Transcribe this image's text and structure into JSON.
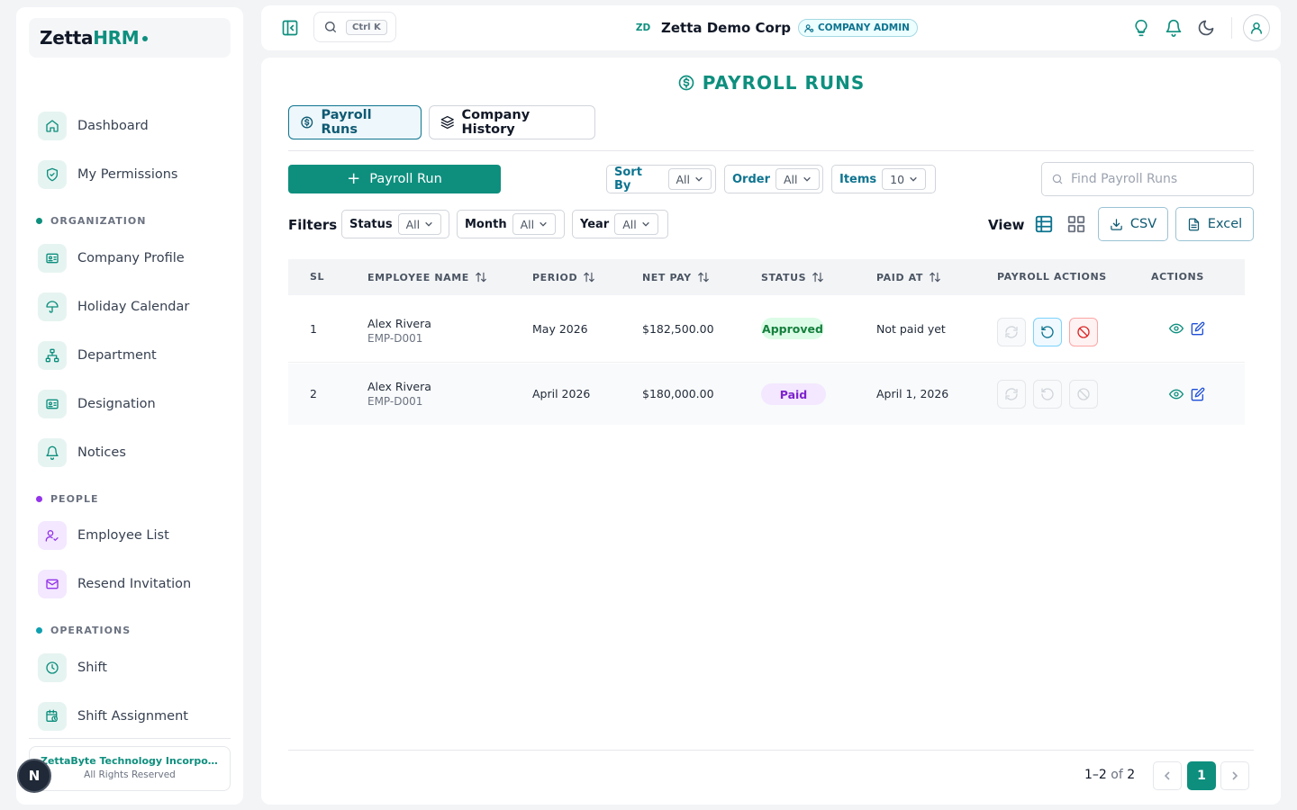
{
  "brand": {
    "name_main": "Zetta",
    "name_accent": "HRM"
  },
  "sidebar": {
    "items": [
      {
        "label": "Dashboard"
      },
      {
        "label": "My Permissions"
      }
    ],
    "sections": [
      {
        "title": "ORGANIZATION",
        "items": [
          {
            "label": "Company Profile"
          },
          {
            "label": "Holiday Calendar"
          },
          {
            "label": "Department"
          },
          {
            "label": "Designation"
          },
          {
            "label": "Notices"
          }
        ]
      },
      {
        "title": "PEOPLE",
        "items": [
          {
            "label": "Employee List"
          },
          {
            "label": "Resend Invitation"
          }
        ]
      },
      {
        "title": "OPERATIONS",
        "items": [
          {
            "label": "Shift"
          },
          {
            "label": "Shift Assignment"
          }
        ]
      }
    ],
    "footer": {
      "company": "ZettaByte Technology Incorporated",
      "rights": "All Rights Reserved"
    },
    "assistant_badge": "N"
  },
  "topbar": {
    "search_shortcut": "Ctrl K",
    "company_initials": "ZD",
    "company_name": "Zetta Demo Corp",
    "role_badge": "COMPANY ADMIN"
  },
  "page": {
    "title": "PAYROLL RUNS",
    "tabs": [
      {
        "label": "Payroll Runs",
        "active": true
      },
      {
        "label": "Company History",
        "active": false
      }
    ],
    "add_button": "Payroll Run",
    "sort": {
      "label": "Sort By",
      "value": "All"
    },
    "order": {
      "label": "Order",
      "value": "All"
    },
    "items": {
      "label": "Items",
      "value": "10"
    },
    "search_placeholder": "Find Payroll Runs",
    "filters_label": "Filters",
    "filters": [
      {
        "label": "Status",
        "value": "All"
      },
      {
        "label": "Month",
        "value": "All"
      },
      {
        "label": "Year",
        "value": "All"
      }
    ],
    "view_label": "View",
    "export_csv": "CSV",
    "export_excel": "Excel"
  },
  "table": {
    "columns": [
      "SL",
      "EMPLOYEE NAME",
      "PERIOD",
      "NET PAY",
      "STATUS",
      "PAID AT",
      "PAYROLL ACTIONS",
      "ACTIONS"
    ],
    "rows": [
      {
        "sl": "1",
        "name": "Alex Rivera",
        "emp_id": "EMP-D001",
        "period": "May 2026",
        "net_pay": "$182,500.00",
        "status": "Approved",
        "paid_at": "Not paid yet"
      },
      {
        "sl": "2",
        "name": "Alex Rivera",
        "emp_id": "EMP-D001",
        "period": "April 2026",
        "net_pay": "$180,000.00",
        "status": "Paid",
        "paid_at": "April 1, 2026"
      }
    ]
  },
  "pagination": {
    "range": "1–2",
    "of_label": "of",
    "total": "2",
    "current_page": "1"
  },
  "colors": {
    "accent": "#0e8f7e",
    "approved": "#15803d",
    "paid": "#7e22ce",
    "cancel": "#dc2626"
  }
}
